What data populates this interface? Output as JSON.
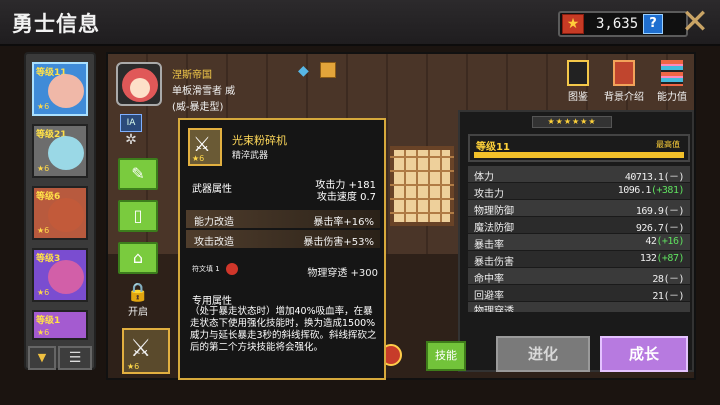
{
  "header": {
    "title": "勇士信息",
    "currency_value": "3,635",
    "help_label": "?",
    "close_label": "✕"
  },
  "hero_list": [
    {
      "level": "等级11",
      "stars": "★6",
      "selected": true
    },
    {
      "level": "等级21",
      "stars": "★6",
      "selected": false
    },
    {
      "level": "等级6",
      "stars": "★6",
      "selected": false
    },
    {
      "level": "等级3",
      "stars": "★6",
      "selected": false
    },
    {
      "level": "等级1",
      "stars": "★6",
      "selected": false
    }
  ],
  "hero": {
    "faction": "涅斯帝国",
    "name": "单板滑雪者 威",
    "style": "(威-暴走型)"
  },
  "nav": {
    "gallery": "图鉴",
    "background": "背景介绍",
    "stats": "能力值"
  },
  "side": {
    "lock_label": "开启",
    "ia_label": "IA"
  },
  "stats_panel": {
    "stars": "★★★★★★",
    "level": "等级11",
    "level_max": "最高值",
    "rows": [
      {
        "key": "体力",
        "value": "40713.1(－)",
        "bonus": ""
      },
      {
        "key": "攻击力",
        "value": "1096.1",
        "bonus": "(+381)"
      },
      {
        "key": "物理防御",
        "value": "169.9(－)",
        "bonus": ""
      },
      {
        "key": "魔法防御",
        "value": "926.7(－)",
        "bonus": ""
      },
      {
        "key": "暴击率",
        "value": "42",
        "bonus": "(+16)"
      },
      {
        "key": "暴击伤害",
        "value": "132",
        "bonus": "(+87)"
      },
      {
        "key": "命中率",
        "value": "28(－)",
        "bonus": ""
      },
      {
        "key": "回避率",
        "value": "21(－)",
        "bonus": ""
      },
      {
        "key": "物理穿透",
        "value": "",
        "bonus": ""
      }
    ]
  },
  "buttons": {
    "skill": "技能",
    "evolve": "进化",
    "grow": "成长"
  },
  "weapon_slot": {
    "stars": "★6"
  },
  "tooltip": {
    "name": "光束粉碎机",
    "subtitle": "精淬武器",
    "stars": "★6",
    "attr_heading": "武器属性",
    "attr_values": "攻击力 +181\n攻击速度 0.7",
    "bands": [
      {
        "key": "能力改造",
        "value": "暴击率+16%"
      },
      {
        "key": "攻击改造",
        "value": "暴击伤害+53%"
      }
    ],
    "glyph_key": "符文填 1",
    "glyph_value": "物理穿透 +300",
    "exclusive_heading": "专用属性",
    "exclusive_desc": "（处于暴走状态时）增加40%吸血率，在暴走状态下使用强化技能时，换为造成1500%威力与延长暴走3秒的斜线挥砍。斜线挥砍之后的第二个方块技能将会强化。"
  }
}
